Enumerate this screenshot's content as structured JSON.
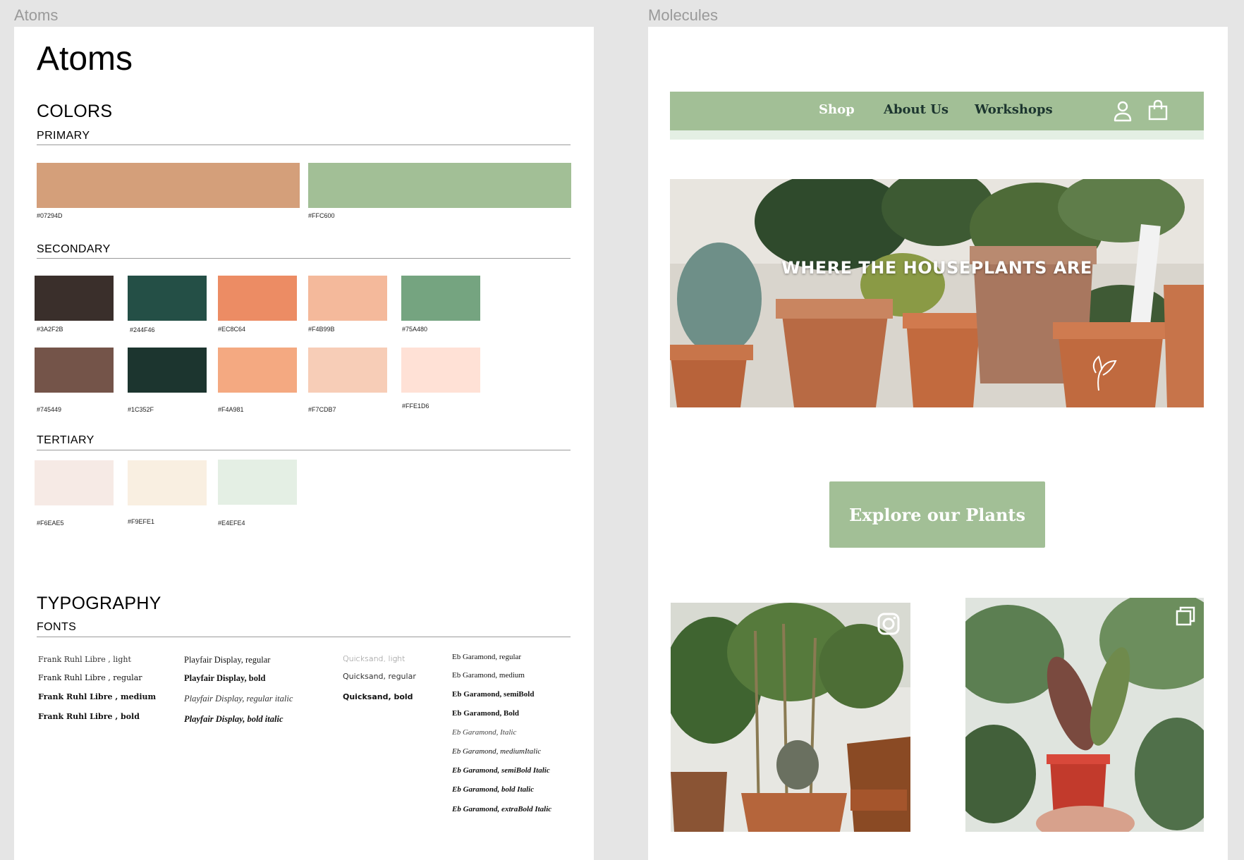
{
  "canvas": {
    "atoms_label": "Atoms",
    "molecules_label": "Molecules"
  },
  "atoms": {
    "title": "Atoms",
    "colors_heading": "COLORS",
    "primary_heading": "PRIMARY",
    "primary": [
      {
        "hex": "#07294D",
        "color": "#d49f7a"
      },
      {
        "hex": "#FFC600",
        "color": "#a2bf96"
      }
    ],
    "secondary_heading": "SECONDARY",
    "secondary": [
      {
        "hex": "#3A2F2B",
        "color": "#3a2f2b"
      },
      {
        "hex": "#244F46",
        "color": "#244f46"
      },
      {
        "hex": "#EC8C64",
        "color": "#ec8c64"
      },
      {
        "hex": "#F4B99B",
        "color": "#f4b99b"
      },
      {
        "hex": "#75A480",
        "color": "#75a480"
      },
      {
        "hex": "#745449",
        "color": "#745449"
      },
      {
        "hex": "#1C352F",
        "color": "#1c352f"
      },
      {
        "hex": "#F4A981",
        "color": "#f4a981"
      },
      {
        "hex": "#F7CDB7",
        "color": "#f7cdb7"
      },
      {
        "hex": "#FFE1D6",
        "color": "#ffe1d6"
      }
    ],
    "tertiary_heading": "TERTIARY",
    "tertiary": [
      {
        "hex": "#F6EAE5",
        "color": "#f6eae5"
      },
      {
        "hex": "#F9EFE1",
        "color": "#f9efe1"
      },
      {
        "hex": "#E4EFE4",
        "color": "#e4efe4"
      }
    ],
    "typography_heading": "TYPOGRAPHY",
    "fonts_heading": "FONTS",
    "fonts": {
      "frank": [
        "Frank Ruhl Libre , light",
        "Frank Ruhl Libre , regular",
        "Frank Ruhl Libre , medium",
        "Frank Ruhl Libre , bold"
      ],
      "playfair": [
        "Playfair Display, regular",
        "Playfair Display, bold",
        "Playfair Display, regular italic",
        "Playfair Display, bold italic"
      ],
      "quicksand": [
        "Quicksand, light",
        "Quicksand, regular",
        "Quicksand, bold"
      ],
      "garamond": [
        "Eb Garamond, regular",
        "Eb Garamond, medium",
        "Eb Garamond, semiBold",
        "Eb Garamond, Bold",
        "Eb Garamond, Italic",
        "Eb Garamond, mediumItalic",
        "Eb Garamond, semiBold Italic",
        "Eb Garamond, bold Italic",
        "Eb Garamond, extraBold Italic"
      ]
    }
  },
  "molecules": {
    "nav": {
      "shop": "Shop",
      "about": "About Us",
      "workshops": "Workshops",
      "account_icon": "user-icon",
      "cart_icon": "shopping-bag-icon"
    },
    "hero": {
      "title": "WHERE THE HOUSEPLANTS ARE",
      "logo_icon": "tulip-logo-icon"
    },
    "cta_label": "Explore our Plants",
    "photo_icons": [
      "instagram-icon",
      "gallery-icon"
    ]
  }
}
